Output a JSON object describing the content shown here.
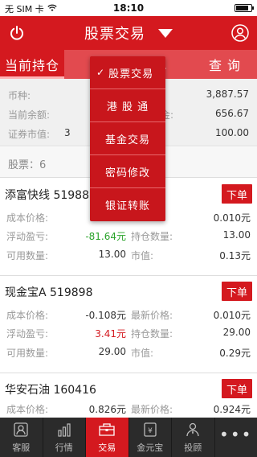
{
  "status_bar": {
    "carrier": "无 SIM 卡",
    "time": "18:10",
    "battery_level": 0.85
  },
  "nav": {
    "title": "股票交易",
    "power_icon": "power-icon",
    "user_icon": "user-icon"
  },
  "tabs": [
    "当前持仓",
    "下",
    "单",
    "查  询"
  ],
  "summary": {
    "currency_label": "币种:",
    "currency_value": "3,887.57",
    "balance_label": "当前余额:",
    "balance_partial_label": "金:",
    "balance_value": "656.67",
    "market_label": "证券市值:",
    "market_mid": "3",
    "market_value": "100.00"
  },
  "stock_count": "股票：6",
  "holdings": [
    {
      "title": "添富快线 519888",
      "order_label": "下单",
      "cost_label": "成本价格:",
      "cost_value": "",
      "latest_label": "",
      "latest_value": "0.010元",
      "pnl_label": "浮动盈亏:",
      "pnl_value": "-81.64元",
      "qty_label": "持仓数量:",
      "qty_value": "13.00",
      "avail_label": "可用数量:",
      "avail_value": "13.00",
      "mv_label": "市值:",
      "mv_value": "0.13元"
    },
    {
      "title": "现金宝A 519898",
      "order_label": "下单",
      "cost_label": "成本价格:",
      "cost_value": "-0.108元",
      "latest_label": "最新价格:",
      "latest_value": "0.010元",
      "pnl_label": "浮动盈亏:",
      "pnl_value": "3.41元",
      "qty_label": "持仓数量:",
      "qty_value": "29.00",
      "avail_label": "可用数量:",
      "avail_value": "29.00",
      "mv_label": "市值:",
      "mv_value": "0.29元"
    },
    {
      "title": "华安石油 160416",
      "order_label": "下单",
      "cost_label": "成本价格:",
      "cost_value": "0.826元",
      "latest_label": "最新价格:",
      "latest_value": "0.924元"
    }
  ],
  "dropdown": {
    "items": [
      "股票交易",
      "港 股 通",
      "基金交易",
      "密码修改",
      "银证转账"
    ],
    "check": "✓"
  },
  "tabbar": {
    "items": [
      {
        "label": "客服",
        "icon": "customer-service-icon"
      },
      {
        "label": "行情",
        "icon": "market-chart-icon"
      },
      {
        "label": "交易",
        "icon": "trade-icon"
      },
      {
        "label": "金元宝",
        "icon": "gold-yuanbao-icon"
      },
      {
        "label": "投顾",
        "icon": "advisor-icon"
      },
      {
        "label": "",
        "icon": "more-icon"
      }
    ],
    "more_glyph": "•••"
  },
  "colors": {
    "brand_red": "#d4191f",
    "gain_red": "#d4191f",
    "loss_green": "#2aa32a",
    "tabbar_bg": "#2b2b2b"
  }
}
